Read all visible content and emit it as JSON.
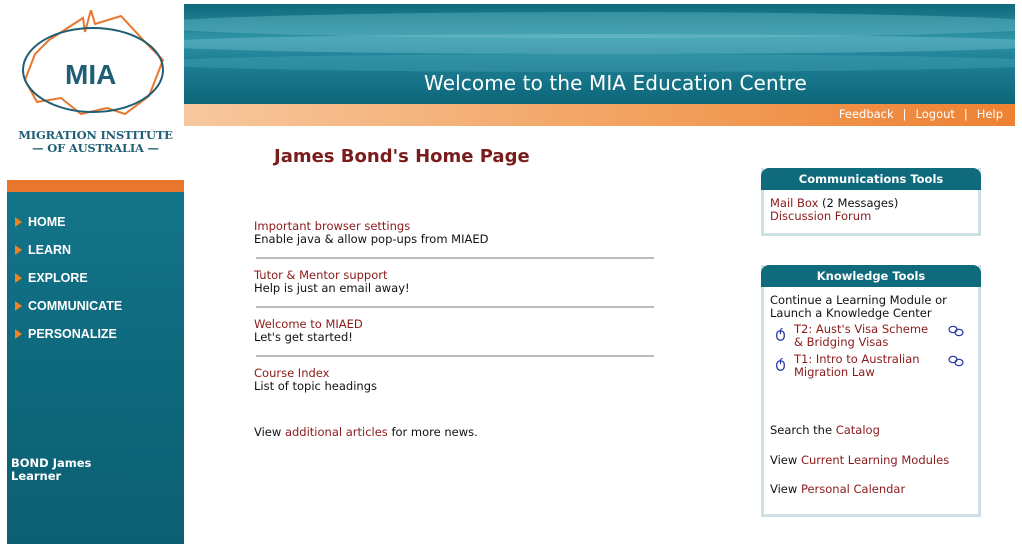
{
  "logo": {
    "text": "MIA",
    "org_line1": "MIGRATION INSTITUTE",
    "org_line2": "— OF AUSTRALIA —"
  },
  "nav": {
    "items": [
      {
        "label": "HOME"
      },
      {
        "label": "LEARN"
      },
      {
        "label": "EXPLORE"
      },
      {
        "label": "COMMUNICATE"
      },
      {
        "label": "PERSONALIZE"
      }
    ]
  },
  "user": {
    "name": "BOND James",
    "role": "Learner"
  },
  "banner": {
    "title": "Welcome to the MIA Education Centre"
  },
  "top_links": {
    "feedback": "Feedback",
    "logout": "Logout",
    "help": "Help",
    "separator": "|"
  },
  "main": {
    "page_title": "James Bond's Home Page",
    "articles": [
      {
        "title": "Important browser settings",
        "desc": "Enable java & allow pop-ups from MIAED"
      },
      {
        "title": "Tutor & Mentor support",
        "desc": "Help is just an email away!"
      },
      {
        "title": "Welcome to MIAED",
        "desc": "Let's get started!"
      },
      {
        "title": "Course Index",
        "desc": "List of topic headings"
      }
    ],
    "more_prefix": "View ",
    "more_link": "additional articles",
    "more_suffix": " for more news."
  },
  "comm_tools": {
    "title": "Communications Tools",
    "mailbox": "Mail Box",
    "mailbox_count": " (2 Messages)",
    "forum": "Discussion Forum"
  },
  "knowledge_tools": {
    "title": "Knowledge Tools",
    "intro_line1": "Continue a Learning Module or",
    "intro_line2": "Launch a Knowledge Center",
    "modules": [
      {
        "line1": "T2: Aust's Visa Scheme",
        "line2": "& Bridging Visas"
      },
      {
        "line1": "T1: Intro to Australian",
        "line2": "Migration Law"
      }
    ],
    "search_prefix": "Search the ",
    "search_link": "Catalog",
    "current_prefix": "View ",
    "current_link": "Current Learning Modules",
    "calendar_prefix": "View ",
    "calendar_link": "Personal Calendar"
  },
  "colors": {
    "teal": "#0f6a7c",
    "orange": "#e8762e",
    "link": "#8b1a1a",
    "title": "#7a1c1c"
  }
}
